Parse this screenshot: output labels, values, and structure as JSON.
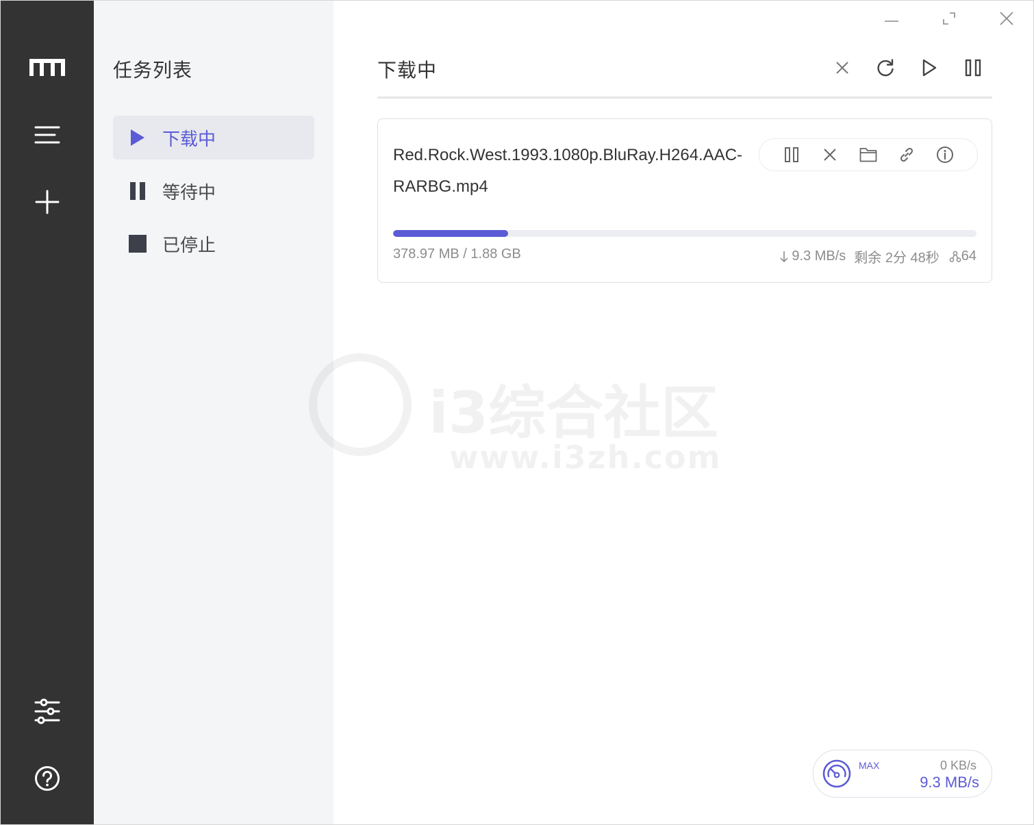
{
  "panel": {
    "title": "任务列表",
    "nav": [
      {
        "label": "下载中",
        "icon": "play-icon",
        "active": true
      },
      {
        "label": "等待中",
        "icon": "pause-icon",
        "active": false
      },
      {
        "label": "已停止",
        "icon": "stop-icon",
        "active": false
      }
    ]
  },
  "main": {
    "title": "下载中"
  },
  "task": {
    "name": "Red.Rock.West.1993.1080p.BluRay.H264.AAC-RARBG.mp4",
    "progress_fraction": 0.197,
    "size_text": "378.97 MB / 1.88 GB",
    "speed_text": "9.3 MB/s",
    "remaining_text": "剩余 2分 48秒",
    "connections_text": "64"
  },
  "speed_meter": {
    "max_label": "MAX",
    "upload": "0 KB/s",
    "download": "9.3 MB/s"
  },
  "watermark": {
    "line1": "i3综合社区",
    "line2": "www.i3zh.com"
  },
  "colors": {
    "accent": "#5b5bd6",
    "rail": "#333333",
    "panel": "#f4f5f7"
  }
}
